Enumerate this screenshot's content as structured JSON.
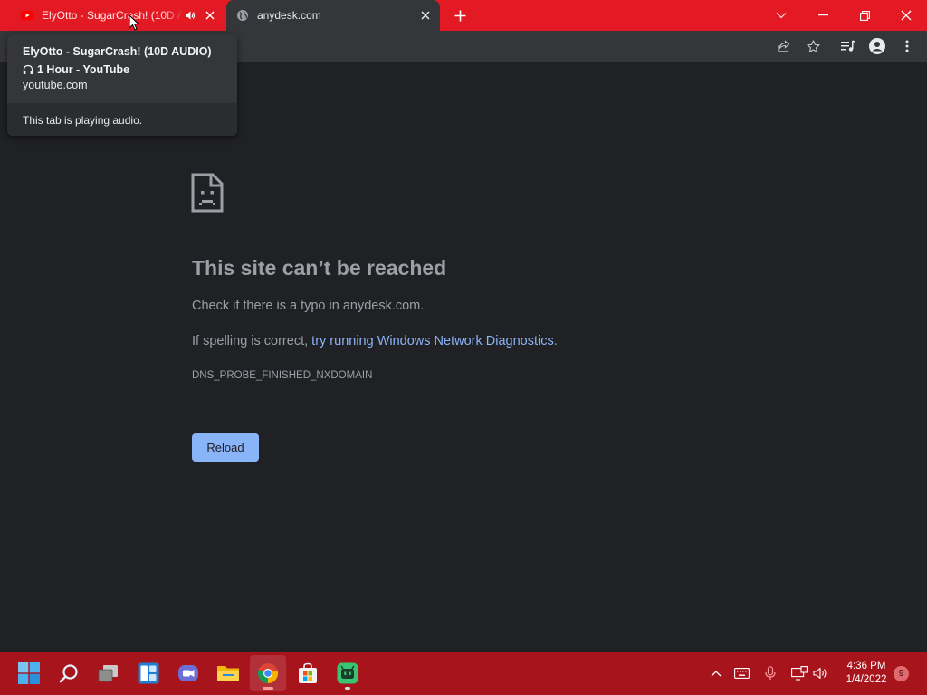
{
  "colors": {
    "titlebar": "#e31a24",
    "taskbar": "#a8141c",
    "page_bg": "#202124",
    "link": "#8ab4f8",
    "reload_bg": "#8ab4f8"
  },
  "tabs": [
    {
      "title": "ElyOtto - SugarCrash! (10D AUDIO)",
      "favicon": "youtube-icon",
      "audio": true,
      "active": false
    },
    {
      "title": "anydesk.com",
      "favicon": "globe-icon",
      "audio": false,
      "active": true
    }
  ],
  "hover_card": {
    "title_line1": "ElyOtto - SugarCrash! (10D AUDIO)",
    "title_line2": "1 Hour - YouTube",
    "domain": "youtube.com",
    "footer": "This tab is playing audio."
  },
  "error": {
    "heading": "This site can’t be reached",
    "line1": "Check if there is a typo in anydesk.com.",
    "line2_prefix": "If spelling is correct, ",
    "line2_link": "try running Windows Network Diagnostics",
    "line2_suffix": ".",
    "code": "DNS_PROBE_FINISHED_NXDOMAIN",
    "reload_label": "Reload"
  },
  "taskbar": {
    "apps": [
      "windows-start-icon",
      "search-icon",
      "task-view-icon",
      "widgets-icon",
      "teams-chat-icon",
      "file-explorer-icon",
      "chrome-icon",
      "microsoft-store-icon",
      "android-app-icon"
    ],
    "active_app": "chrome-icon",
    "time": "4:36 PM",
    "date": "1/4/2022",
    "notification_count": "9"
  }
}
